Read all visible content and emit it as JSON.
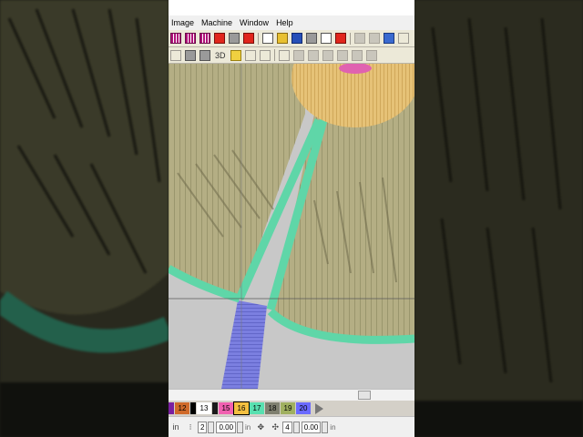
{
  "menu": [
    "Image",
    "Machine",
    "Window",
    "Help"
  ],
  "toolbar1": [
    "stitch-pattern-icon",
    "stitch-pattern-icon",
    "stitch-pattern-icon",
    "stitch-color-icon",
    "select-icon",
    "wizard-icon",
    "new-file-icon",
    "open-folder-icon",
    "save-icon",
    "print-icon",
    "print-preview-icon",
    "export-icon",
    "cut-icon",
    "copy-icon",
    "paste-icon",
    "undo-icon"
  ],
  "toolbar2": {
    "left_icons": [
      "design-icon",
      "grid-icon",
      "list-icon"
    ],
    "view_3d_label": "3D",
    "right_icons": [
      "fill-icon",
      "outline-icon",
      "border-icon",
      "lettering-icon",
      "monogram-icon",
      "motif-icon",
      "appliqué-icon",
      "trim-icon",
      "tie-icon",
      "align-icon"
    ]
  },
  "palette": {
    "swatches": [
      {
        "num": "",
        "color": "#7a1fa0"
      },
      {
        "num": "12",
        "color": "#d06a2a"
      },
      {
        "num": "",
        "color": "#000000"
      },
      {
        "num": "13",
        "color": "#ffffff"
      },
      {
        "num": "",
        "color": "#1a1a1a"
      },
      {
        "num": "15",
        "color": "#f060b0"
      },
      {
        "num": "16",
        "color": "#f4c040"
      },
      {
        "num": "17",
        "color": "#58e0b0"
      },
      {
        "num": "18",
        "color": "#808070"
      },
      {
        "num": "19",
        "color": "#a0b060"
      },
      {
        "num": "20",
        "color": "#6a6aff"
      }
    ],
    "selected": "16"
  },
  "statusbar": {
    "field1": "2",
    "field2": "0.00",
    "field3": "4",
    "field4": "0.00",
    "unit": "in"
  },
  "colors": {
    "satin_green": "#5fd6a8",
    "fill_yellow": "#b8b07a",
    "center_gold": "#e8c878",
    "stem_blue": "#7b7fe0",
    "canvas_gray": "#c8c8c8"
  }
}
